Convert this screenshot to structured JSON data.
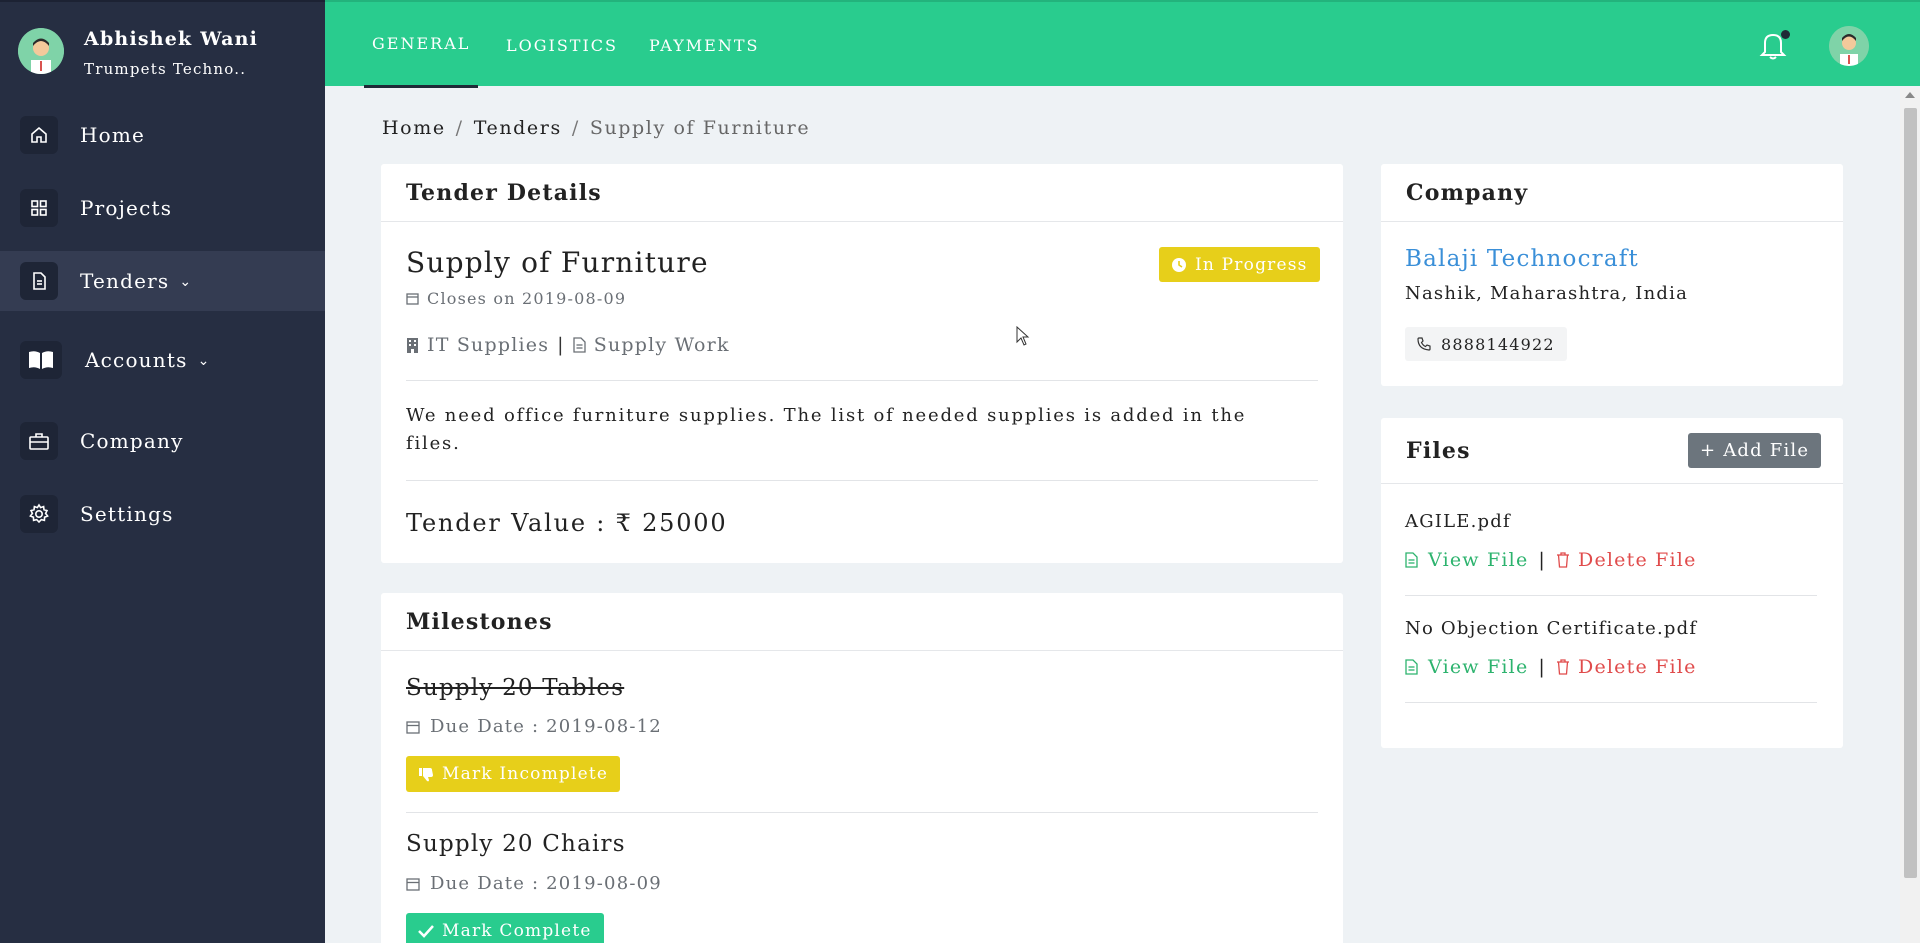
{
  "sidebar": {
    "user_name": "Abhishek Wani",
    "user_org": "Trumpets Techno..",
    "items": [
      {
        "label": "Home",
        "icon": "home-icon"
      },
      {
        "label": "Projects",
        "icon": "grid-icon"
      },
      {
        "label": "Tenders",
        "icon": "document-icon"
      },
      {
        "label": "Accounts",
        "icon": "book-icon"
      },
      {
        "label": "Company",
        "icon": "briefcase-icon"
      },
      {
        "label": "Settings",
        "icon": "gear-icon"
      }
    ]
  },
  "topbar": {
    "tabs": [
      "GENERAL",
      "LOGISTICS",
      "PAYMENTS"
    ],
    "active_tab": "GENERAL"
  },
  "breadcrumb": [
    "Home",
    "Tenders",
    "Supply of Furniture"
  ],
  "tender": {
    "card_title": "Tender Details",
    "title": "Supply of Furniture",
    "status": "In Progress",
    "closes": "Closes on 2019-08-09",
    "category": "IT Supplies",
    "work_type": "Supply Work",
    "description": "We need office furniture supplies. The list of needed supplies is added in the files.",
    "value_label": "Tender Value : ₹ 25000"
  },
  "milestones": {
    "card_title": "Milestones",
    "items": [
      {
        "title": "Supply 20 Tables",
        "due": "Due Date : 2019-08-12",
        "action": "Mark Incomplete",
        "done": true
      },
      {
        "title": "Supply 20 Chairs",
        "due": "Due Date : 2019-08-09",
        "action": "Mark Complete",
        "done": false
      }
    ]
  },
  "company": {
    "card_title": "Company",
    "name": "Balaji Technocraft",
    "location": "Nashik, Maharashtra, India",
    "phone": "8888144922"
  },
  "files": {
    "card_title": "Files",
    "add_label": "+ Add File",
    "view_label": "View File",
    "delete_label": "Delete File",
    "separator": "|",
    "items": [
      {
        "name": "AGILE.pdf"
      },
      {
        "name": "No Objection Certificate.pdf"
      }
    ]
  },
  "colors": {
    "sidebar": "#262e42",
    "topbar": "#29cc8e",
    "badge_yellow": "#e7cf1a",
    "link_blue": "#3a8fd8",
    "link_green": "#2db36e",
    "link_red": "#e04b4b"
  }
}
